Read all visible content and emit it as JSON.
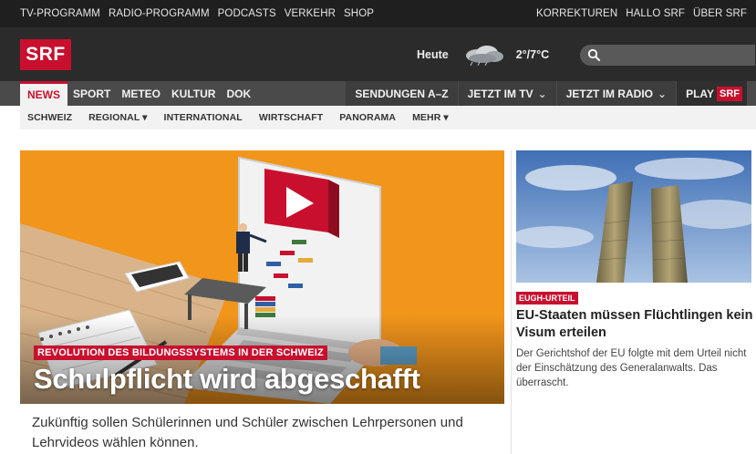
{
  "topbar": {
    "left_links": [
      "TV-PROGRAMM",
      "RADIO-PROGRAMM",
      "PODCASTS",
      "VERKEHR",
      "SHOP"
    ],
    "right_links": [
      "KORREKTUREN",
      "HALLO SRF",
      "ÜBER SRF"
    ]
  },
  "header": {
    "logo": "SRF",
    "weather_day": "Heute",
    "weather_icon": "cloud-icon",
    "weather_temp": "2°/7°C",
    "search_icon": "search-icon",
    "search_value": ""
  },
  "main_nav": {
    "left_items": [
      "NEWS",
      "SPORT",
      "METEO",
      "KULTUR",
      "DOK"
    ],
    "active_item": "NEWS",
    "right_items": [
      {
        "label": "SENDUNGEN A–Z",
        "caret": ""
      },
      {
        "label": "JETZT IM TV",
        "caret": "⌄"
      },
      {
        "label": "JETZT IM RADIO",
        "caret": "⌄"
      }
    ],
    "play_label": "PLAY",
    "play_badge": "SRF"
  },
  "sub_nav": {
    "items": [
      "SCHWEIZ",
      "REGIONAL ▾",
      "INTERNATIONAL",
      "WIRTSCHAFT",
      "PANORAMA",
      "MEHR ▾"
    ]
  },
  "hero": {
    "kicker": "REVOLUTION DES BILDUNGSSYSTEMS IN DER SCHWEIZ",
    "title": "Schulpflicht wird abgeschafft",
    "lead": "Zukünftig sollen Schülerinnen und Schüler zwischen Lehrpersonen und Lehrvideos wählen können."
  },
  "side_article": {
    "kicker": "EUGH-URTEIL",
    "title": "EU-Staaten müssen Flüchtlingen kein Visum erteilen",
    "text": "Der Gerichtshof der EU folgte mit dem Urteil nicht der Einschätzung des Generalanwalts. Das überrascht."
  },
  "colors": {
    "brand_red": "#c8102e",
    "hero_orange": "#f2951b",
    "header_dark": "#2b2b2b"
  }
}
